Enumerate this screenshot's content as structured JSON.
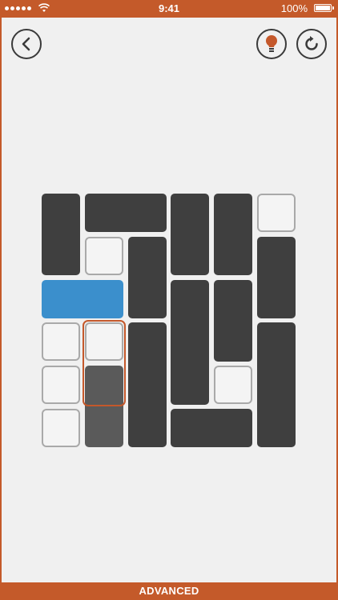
{
  "status_bar": {
    "time": "9:41",
    "battery": "100%"
  },
  "level": {
    "difficulty": "ADVANCED"
  },
  "toolbar": {
    "back_icon": "chevron-left-icon",
    "hint_icon": "lightbulb-icon",
    "reset_icon": "restart-icon"
  },
  "colors": {
    "accent": "#c45a2a",
    "block": "#3f3f3f",
    "target_block": "#3b8fcc",
    "selected_block": "#5a5a5a",
    "background": "#f0f0f0"
  }
}
